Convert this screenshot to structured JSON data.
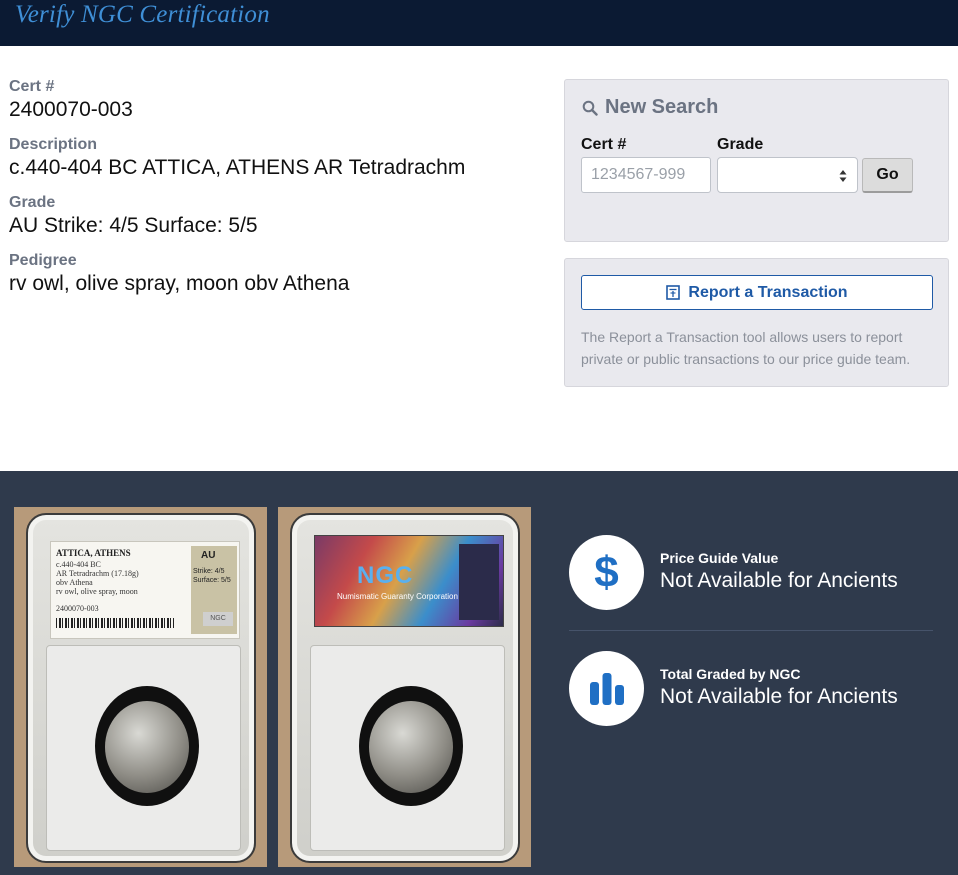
{
  "header": {
    "title": "Verify NGC Certification"
  },
  "details": {
    "cert_label": "Cert #",
    "cert_value": "2400070-003",
    "description_label": "Description",
    "description_value": "c.440-404 BC ATTICA, ATHENS AR Tetradrachm",
    "grade_label": "Grade",
    "grade_value": "AU Strike: 4/5 Surface: 5/5",
    "pedigree_label": "Pedigree",
    "pedigree_value": "rv owl, olive spray, moon obv Athena"
  },
  "search": {
    "heading": "New Search",
    "cert_label": "Cert #",
    "cert_placeholder": "1234567-999",
    "grade_label": "Grade",
    "grade_value": "",
    "go_label": "Go"
  },
  "report": {
    "button_label": "Report a Transaction",
    "description": "The Report a Transaction tool allows users to report private or public transactions to our price guide team."
  },
  "label_card": {
    "title": "ATTICA, ATHENS",
    "lines": [
      "c.440-404 BC",
      "AR Tetradrachm (17.18g)",
      "obv Athena",
      "rv owl, olive spray, moon",
      "2400070-003"
    ],
    "grade": "AU",
    "strike": "Strike: 4/5",
    "surface": "Surface: 5/5",
    "brand": "NGC"
  },
  "hologram": {
    "brand": "NGC",
    "sub": "Numismatic Guaranty Corporation"
  },
  "stats": {
    "price_title": "Price Guide Value",
    "price_value": "Not Available for Ancients",
    "graded_title": "Total Graded by NGC",
    "graded_value": "Not Available for Ancients"
  },
  "colors": {
    "header_bg": "#0b1a33",
    "accent": "#1f5aa6",
    "bottom_bg": "#2f3a4c",
    "icon_blue": "#1f6fc4"
  }
}
